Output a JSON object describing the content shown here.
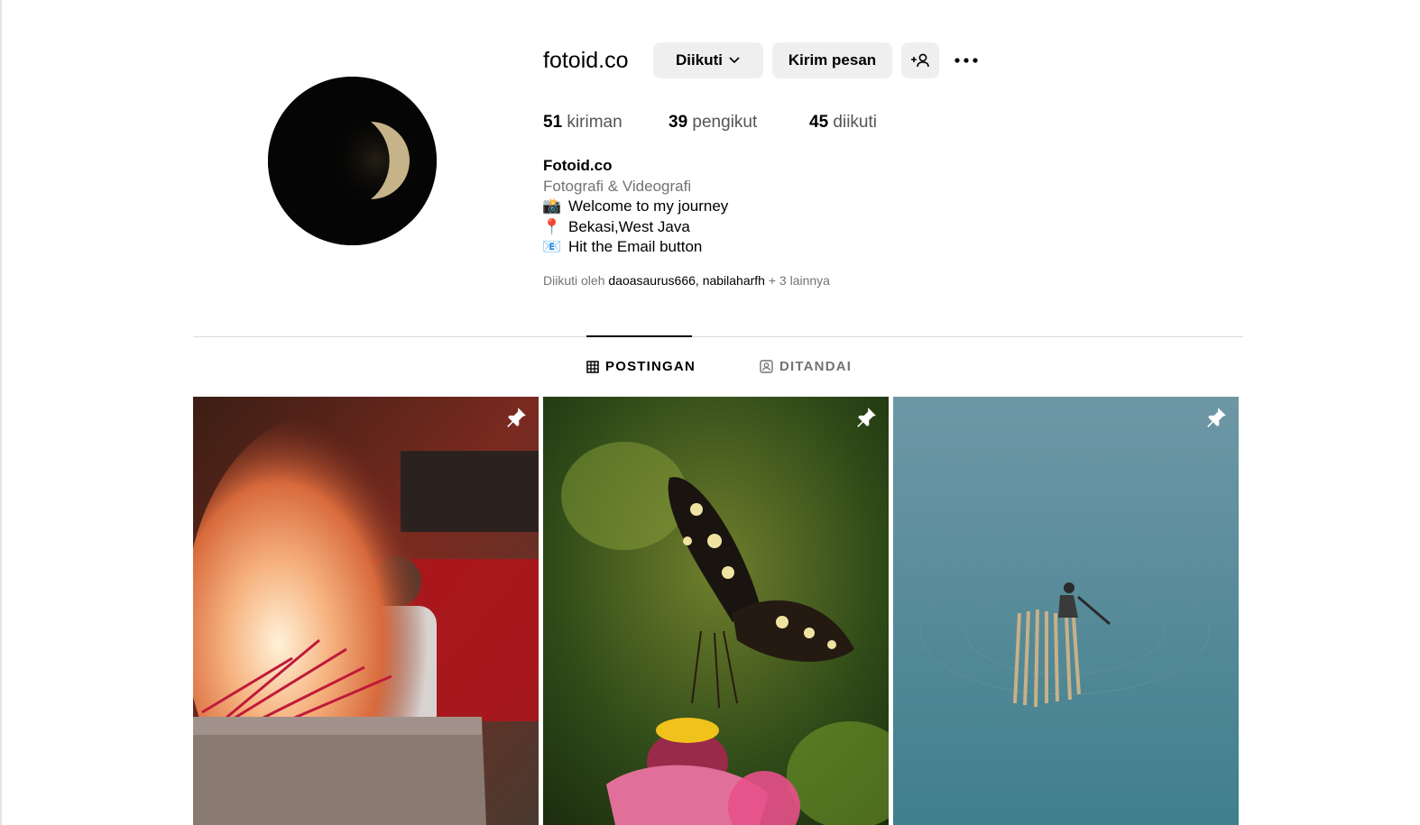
{
  "profile": {
    "username": "fotoid.co",
    "buttons": {
      "following_label": "Diikuti",
      "message_label": "Kirim pesan"
    },
    "stats": {
      "posts_count": "51",
      "posts_label": "kiriman",
      "followers_count": "39",
      "followers_label": "pengikut",
      "following_count": "45",
      "following_label": "diikuti"
    },
    "bio": {
      "name": "Fotoid.co",
      "category": "Fotografi & Videografi",
      "lines": [
        {
          "emoji": "📸",
          "text": "Welcome to my journey"
        },
        {
          "emoji": "📍",
          "text": "Bekasi,West Java"
        },
        {
          "emoji": "📧",
          "text": "Hit the Email button"
        }
      ]
    },
    "followed_by": {
      "prefix": "Diikuti oleh",
      "user1": "daoasaurus666",
      "separator": ",",
      "user2": "nabilaharfh",
      "suffix": "+ 3 lainnya"
    }
  },
  "tabs": [
    {
      "label": "POSTINGAN",
      "icon": "grid-icon",
      "active": true
    },
    {
      "label": "DITANDAI",
      "icon": "tagged-icon",
      "active": false
    }
  ],
  "posts": [
    {
      "subject": "incense-fire",
      "pinned": true
    },
    {
      "subject": "butterfly-flower",
      "pinned": true
    },
    {
      "subject": "bamboo-raft",
      "pinned": true
    }
  ],
  "colors": {
    "button_bg": "#efefef",
    "muted_text": "#737373",
    "divider": "#dbdbdb"
  }
}
